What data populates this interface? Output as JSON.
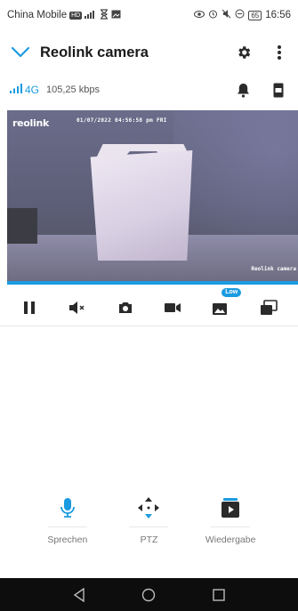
{
  "status_bar": {
    "carrier": "China Mobile",
    "hd_badge": "HD",
    "signal_text": "4G",
    "battery_level": "65",
    "time": "16:56"
  },
  "app_bar": {
    "title": "Reolink camera",
    "back_icon": "chevron-down-icon",
    "settings_icon": "gear-icon",
    "more_icon": "more-vertical-icon"
  },
  "connection": {
    "network_type": "4G",
    "bitrate": "105,25 kbps",
    "bell_icon": "bell-icon",
    "device_icon": "camera-device-icon"
  },
  "video": {
    "logo": "reolink",
    "timestamp": "01/07/2022 04:56:58 pm FRI",
    "watermark": "Reolink camera"
  },
  "controls": {
    "items": [
      "pause",
      "mute",
      "snapshot",
      "record",
      "quality",
      "multi-view"
    ],
    "quality_badge": "Low"
  },
  "actions": [
    {
      "label": "Sprechen",
      "icon": "microphone-icon"
    },
    {
      "label": "PTZ",
      "icon": "ptz-arrows-icon"
    },
    {
      "label": "Wiedergabe",
      "icon": "playback-icon"
    }
  ],
  "colors": {
    "accent": "#1b9be0",
    "nav_bar": "#0d0d0d",
    "icon_dark": "#2a2a2a"
  }
}
